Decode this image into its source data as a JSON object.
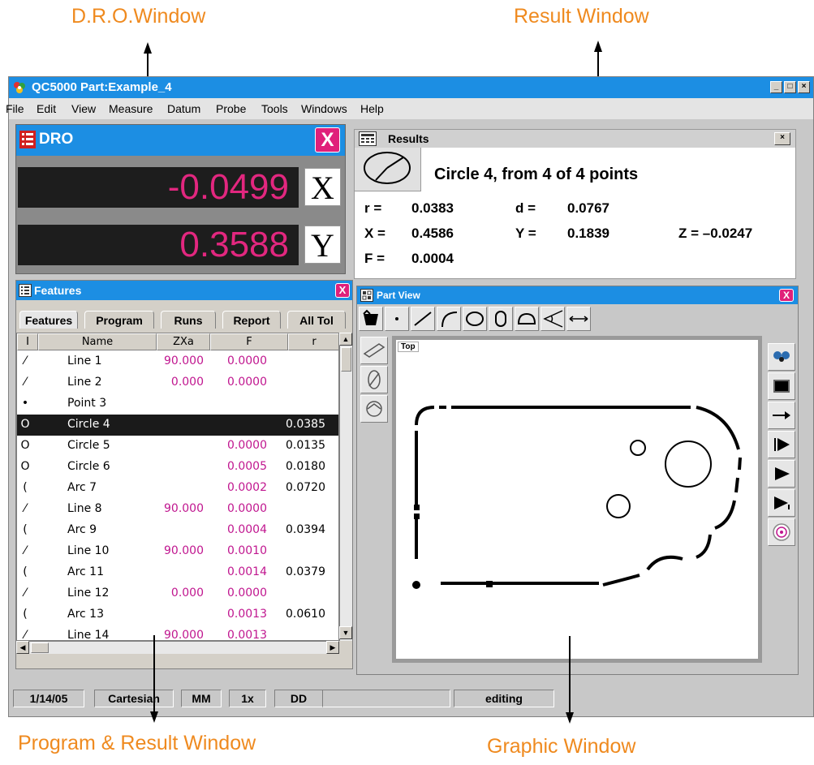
{
  "callouts": {
    "dro": "D.R.O.Window",
    "result": "Result Window",
    "program": "Program & Result Window",
    "graphic": "Graphic Window"
  },
  "window": {
    "title": "QC5000 Part:Example_4",
    "minimize": "_",
    "maximize": "□",
    "close": "×"
  },
  "menu": [
    "File",
    "Edit",
    "View",
    "Measure",
    "Datum",
    "Probe",
    "Tools",
    "Windows",
    "Help"
  ],
  "dro": {
    "title": "DRO",
    "close": "X",
    "x_value": "-0.0499",
    "x_label": "X",
    "y_value": "0.3588",
    "y_label": "Y"
  },
  "results": {
    "title": "Results",
    "close": "×",
    "heading": "Circle  4,  from  4  of  4  points",
    "r_label": "r  =",
    "r_value": "0.0383",
    "d_label": "d  =",
    "d_value": "0.0767",
    "x_label": "X =",
    "x_value": "0.4586",
    "y_label": "Y =",
    "y_value": "0.1839",
    "z_text": "Z = –0.0247",
    "f_label": "F =",
    "f_value": "0.0004"
  },
  "features": {
    "title": "Features",
    "close": "X",
    "tabs": [
      "Features",
      "Program",
      "Runs",
      "Report",
      "All Tol"
    ],
    "columns": [
      "I",
      "Name",
      "ZXa",
      "F",
      "r"
    ],
    "rows": [
      {
        "icon": "⁄",
        "name": "Line  1",
        "zxa": "90.000",
        "f": "0.0000",
        "r": ""
      },
      {
        "icon": "⁄",
        "name": "Line  2",
        "zxa": "0.000",
        "f": "0.0000",
        "r": ""
      },
      {
        "icon": "•",
        "name": "Point 3",
        "zxa": "",
        "f": "",
        "r": ""
      },
      {
        "icon": "O",
        "name": "Circle 4",
        "zxa": "",
        "f": "",
        "r": "0.0385"
      },
      {
        "icon": "O",
        "name": "Circle 5",
        "zxa": "",
        "f": "0.0000",
        "r": "0.0135"
      },
      {
        "icon": "O",
        "name": "Circle 6",
        "zxa": "",
        "f": "0.0005",
        "r": "0.0180"
      },
      {
        "icon": "(",
        "name": "Arc 7",
        "zxa": "",
        "f": "0.0002",
        "r": "0.0720"
      },
      {
        "icon": "⁄",
        "name": "Line 8",
        "zxa": "90.000",
        "f": "0.0000",
        "r": ""
      },
      {
        "icon": "(",
        "name": "Arc 9",
        "zxa": "",
        "f": "0.0004",
        "r": "0.0394"
      },
      {
        "icon": "⁄",
        "name": "Line 10",
        "zxa": "90.000",
        "f": "0.0010",
        "r": ""
      },
      {
        "icon": "(",
        "name": "Arc 11",
        "zxa": "",
        "f": "0.0014",
        "r": "0.0379"
      },
      {
        "icon": "⁄",
        "name": "Line 12",
        "zxa": "0.000",
        "f": "0.0000",
        "r": ""
      },
      {
        "icon": "(",
        "name": "Arc 13",
        "zxa": "",
        "f": "0.0013",
        "r": "0.0610"
      },
      {
        "icon": "⁄",
        "name": "Line 14",
        "zxa": "90.000",
        "f": "0.0013",
        "r": ""
      }
    ]
  },
  "partview": {
    "title": "Part View",
    "close": "X",
    "view_label": "Top"
  },
  "status": {
    "date": "1/14/05",
    "coords": "Cartesian",
    "units": "MM",
    "zoom": "1x",
    "angle": "DD",
    "blank": "",
    "mode": "editing"
  }
}
